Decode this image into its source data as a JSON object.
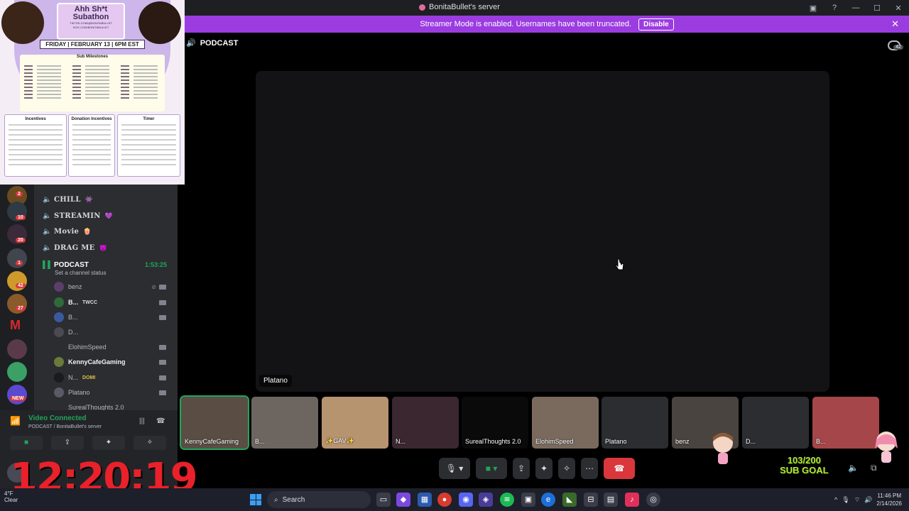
{
  "window": {
    "title": "BonitaBullet's server"
  },
  "banner": {
    "text": "Streamer Mode is enabled. Usernames have been truncated.",
    "button": "Disable"
  },
  "stage": {
    "channel": "PODCAST",
    "chat_count": "42",
    "tile_name": "Platano"
  },
  "overlay": {
    "title": "Ahh Sh*t Subathon",
    "link1": "TIKTOK.COM/@BONITABULLET",
    "link2": "KICK.COM/BONITABULLET",
    "date": "FRIDAY | FEBRUARY 13 | 6PM EST",
    "milestones_title": "Sub Milestones",
    "incentives_title": "Incentives",
    "donation_title": "Donation Incentives",
    "timer_title": "Timer"
  },
  "server_badges": [
    "2",
    "10",
    "20",
    "1",
    "42",
    "27",
    "NEW"
  ],
  "channels": [
    {
      "name": "CHILL",
      "deco": "👾"
    },
    {
      "name": "STREAMIN",
      "deco": "💜"
    },
    {
      "name": "Movie",
      "deco": "🍿"
    },
    {
      "name": "DRAG ME",
      "deco": "😈"
    }
  ],
  "podcast": {
    "name": "PODCAST",
    "time": "1:53:25",
    "status": "Set a channel status"
  },
  "members": [
    {
      "name": "benz",
      "tag": ""
    },
    {
      "name": "B...",
      "tag": "TWCC"
    },
    {
      "name": "B...",
      "tag": ""
    },
    {
      "name": "D...",
      "tag": ""
    },
    {
      "name": "ElohimSpeed",
      "tag": ""
    },
    {
      "name": "KennyCafeGaming",
      "tag": ""
    },
    {
      "name": "N...",
      "tag": "DOMI"
    },
    {
      "name": "Platano",
      "tag": ""
    },
    {
      "name": "SurealThoughts 2.0",
      "tag": ""
    }
  ],
  "voice": {
    "status": "Video Connected",
    "location": "PODCAST / BonitaBullet's server"
  },
  "clock": "12:20:19",
  "strip": [
    {
      "name": "KennyCafeGaming",
      "color": "#5a4e44"
    },
    {
      "name": "B...",
      "color": "#6d6660"
    },
    {
      "name": "✨GAV✨",
      "color": "#b79470"
    },
    {
      "name": "N...",
      "color": "#3a2730"
    },
    {
      "name": "SurealThoughts 2.0",
      "color": "#0a0a0a"
    },
    {
      "name": "ElohimSpeed",
      "color": "#7a6a5e"
    },
    {
      "name": "Platano",
      "color": "#2b2d31"
    },
    {
      "name": "benz",
      "color": "#4a4440"
    },
    {
      "name": "D...",
      "color": "#2b2d31"
    },
    {
      "name": "B...",
      "color": "#a5464a"
    }
  ],
  "sub_goal": {
    "count": "103/200",
    "label": "SUB GOAL"
  },
  "taskbar": {
    "weather": "4°F",
    "weather_sub": "Clear",
    "search": "Search",
    "time": "11:46 PM",
    "date": "2/14/2026"
  }
}
